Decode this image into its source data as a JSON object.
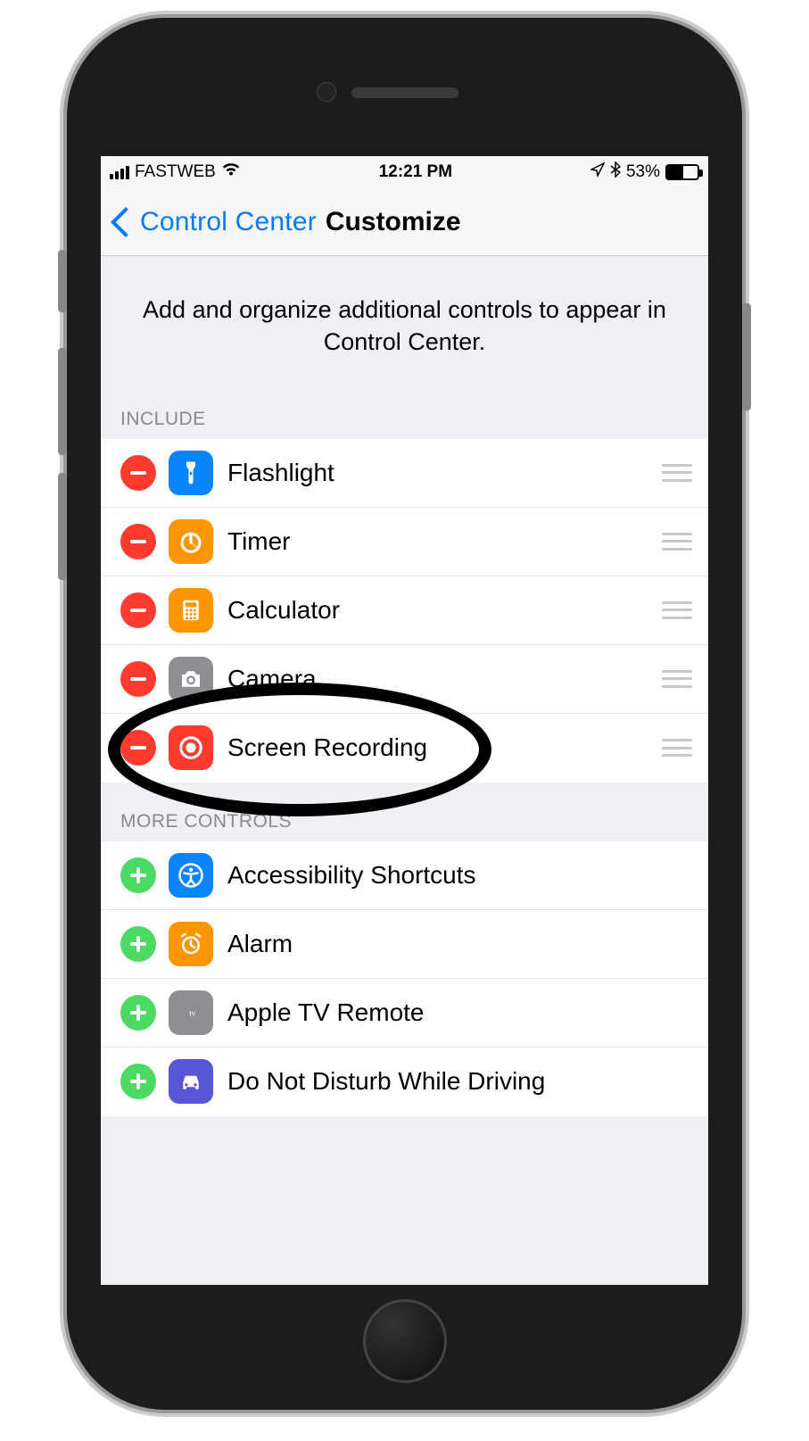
{
  "status": {
    "carrier": "FASTWEB",
    "time": "12:21 PM",
    "battery_pct": "53%"
  },
  "nav": {
    "back_label": "Control Center",
    "title": "Customize"
  },
  "description": "Add and organize additional controls to appear in Control Center.",
  "sections": {
    "include_header": "INCLUDE",
    "more_header": "MORE CONTROLS"
  },
  "include": [
    {
      "label": "Flashlight"
    },
    {
      "label": "Timer"
    },
    {
      "label": "Calculator"
    },
    {
      "label": "Camera"
    },
    {
      "label": "Screen Recording"
    }
  ],
  "more": [
    {
      "label": "Accessibility Shortcuts"
    },
    {
      "label": "Alarm"
    },
    {
      "label": "Apple TV Remote"
    },
    {
      "label": "Do Not Disturb While Driving"
    }
  ],
  "highlight": {
    "target": "screen-recording-row"
  }
}
